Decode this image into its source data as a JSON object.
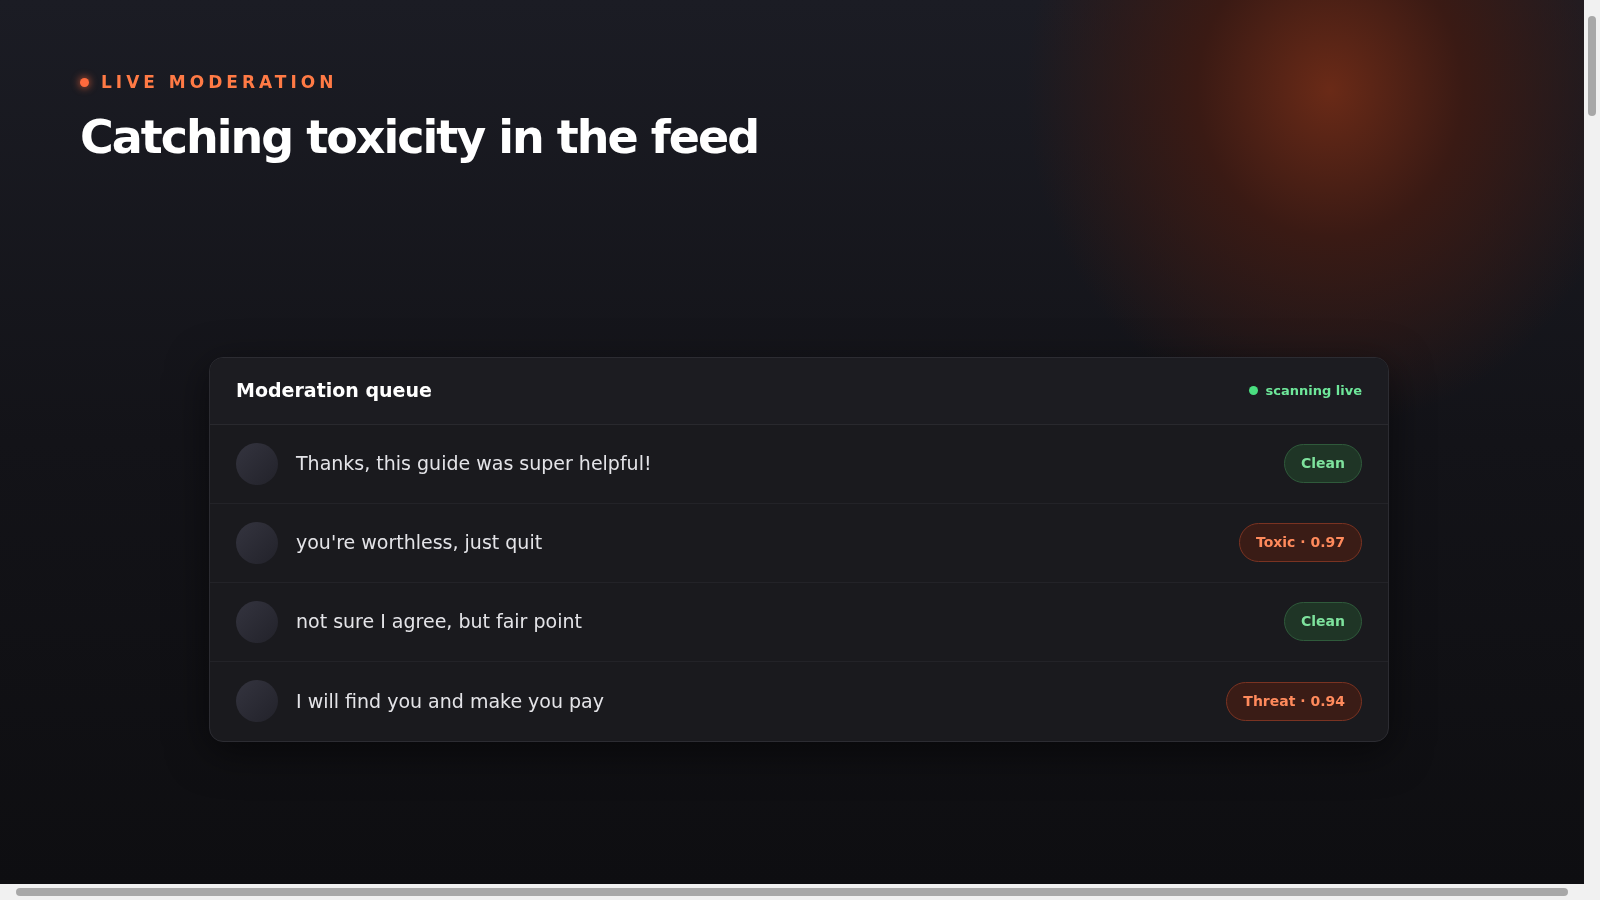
{
  "eyebrow": "LIVE MODERATION",
  "title": "Catching toxicity in the feed",
  "queue": {
    "title": "Moderation queue",
    "status": "scanning live",
    "items": [
      {
        "text": "Thanks, this guide was super helpful!",
        "label": "Clean",
        "kind": "clean"
      },
      {
        "text": "you're worthless, just quit",
        "label": "Toxic · 0.97",
        "kind": "flagged"
      },
      {
        "text": "not sure I agree, but fair point",
        "label": "Clean",
        "kind": "clean"
      },
      {
        "text": "I will find you and make you pay",
        "label": "Threat · 0.94",
        "kind": "flagged"
      }
    ]
  }
}
